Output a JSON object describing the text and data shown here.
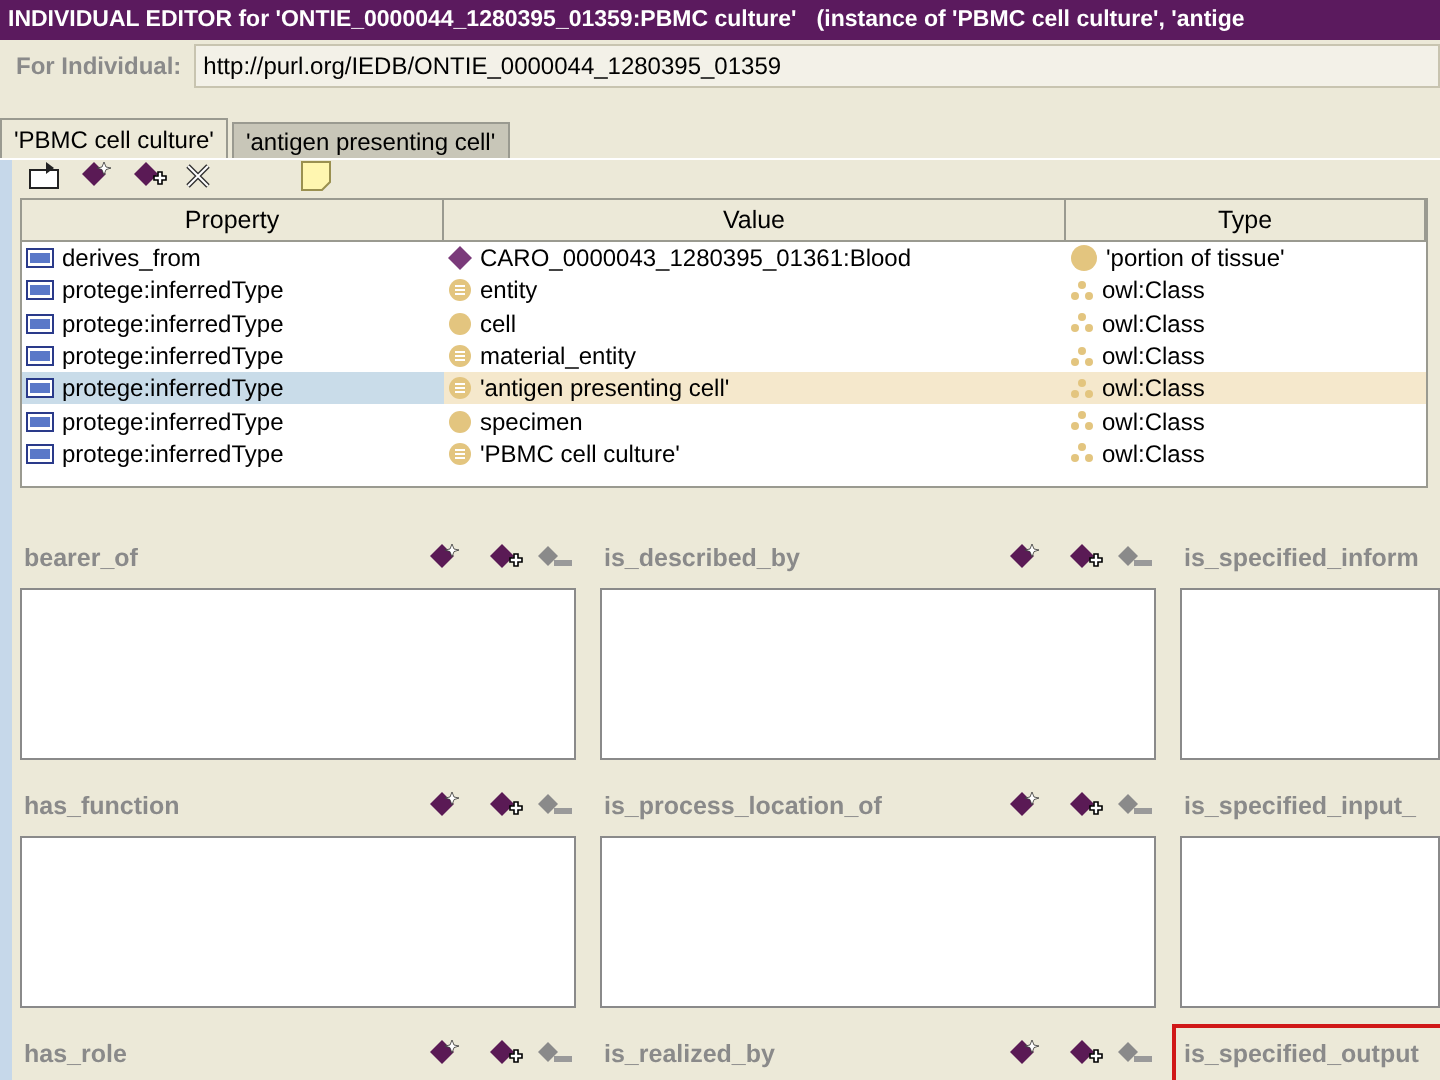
{
  "window": {
    "title": "INDIVIDUAL EDITOR for 'ONTIE_0000044_1280395_01359:PBMC culture'",
    "subtitle": "(instance of 'PBMC cell culture', 'antige"
  },
  "individual": {
    "label": "For Individual:",
    "value": "http://purl.org/IEDB/ONTIE_0000044_1280395_01359"
  },
  "tabs": [
    {
      "label": "'PBMC cell culture'",
      "selected": true
    },
    {
      "label": "'antigen presenting cell'",
      "selected": false
    }
  ],
  "table": {
    "columns": [
      "Property",
      "Value",
      "Type"
    ],
    "rows": [
      {
        "property": "derives_from",
        "value": {
          "text": "CARO_0000043_1280395_01361:Blood",
          "kind": "individual"
        },
        "type": {
          "text": "'portion of tissue'",
          "kind": "class"
        },
        "selected": false
      },
      {
        "property": "protege:inferredType",
        "value": {
          "text": "entity",
          "kind": "defined"
        },
        "type": {
          "text": "owl:Class",
          "kind": "metaclass"
        },
        "selected": false
      },
      {
        "property": "protege:inferredType",
        "value": {
          "text": "cell",
          "kind": "class"
        },
        "type": {
          "text": "owl:Class",
          "kind": "metaclass"
        },
        "selected": false
      },
      {
        "property": "protege:inferredType",
        "value": {
          "text": "material_entity",
          "kind": "defined"
        },
        "type": {
          "text": "owl:Class",
          "kind": "metaclass"
        },
        "selected": false
      },
      {
        "property": "protege:inferredType",
        "value": {
          "text": "'antigen presenting cell'",
          "kind": "defined"
        },
        "type": {
          "text": "owl:Class",
          "kind": "metaclass"
        },
        "selected": true
      },
      {
        "property": "protege:inferredType",
        "value": {
          "text": "specimen",
          "kind": "class"
        },
        "type": {
          "text": "owl:Class",
          "kind": "metaclass"
        },
        "selected": false
      },
      {
        "property": "protege:inferredType",
        "value": {
          "text": "'PBMC cell culture'",
          "kind": "defined"
        },
        "type": {
          "text": "owl:Class",
          "kind": "metaclass"
        },
        "selected": false
      }
    ]
  },
  "panels": [
    {
      "label": "bearer_of",
      "highlighted": false,
      "tools": true
    },
    {
      "label": "is_described_by",
      "highlighted": false,
      "tools": true
    },
    {
      "label": "is_specified_inform",
      "highlighted": false,
      "tools": false
    },
    {
      "label": "has_function",
      "highlighted": false,
      "tools": true
    },
    {
      "label": "is_process_location_of",
      "highlighted": false,
      "tools": true
    },
    {
      "label": "is_specified_input_",
      "highlighted": false,
      "tools": false
    },
    {
      "label": "has_role",
      "highlighted": false,
      "tools": true
    },
    {
      "label": "is_realized_by",
      "highlighted": false,
      "tools": true
    },
    {
      "label": "is_specified_output",
      "highlighted": true,
      "tools": false
    }
  ]
}
